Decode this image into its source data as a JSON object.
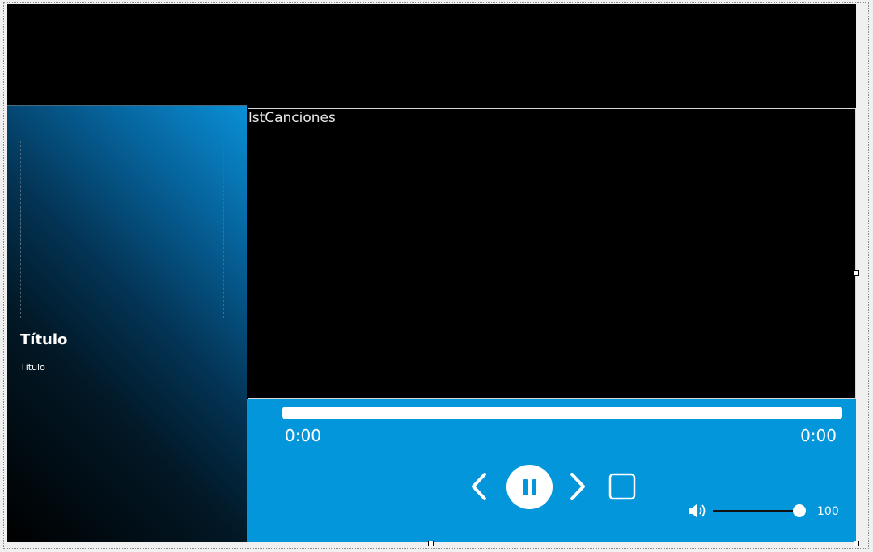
{
  "album": {
    "title": "Título",
    "subtitle": "Título"
  },
  "song_list": {
    "label": "lstCanciones"
  },
  "player": {
    "progress": 1.0,
    "time_elapsed": "0:00",
    "time_total": "0:00",
    "controls": {
      "previous_icon": "chevron-left-icon",
      "play_pause_icon": "pause-icon",
      "next_icon": "chevron-right-icon",
      "stop_icon": "stop-square-icon"
    },
    "volume": {
      "icon": "speaker-icon",
      "value": "100",
      "level": 100
    }
  },
  "colors": {
    "player_background": "#0396db",
    "panel_gradient_start": "#0a8fd6",
    "form_background": "#000000"
  }
}
